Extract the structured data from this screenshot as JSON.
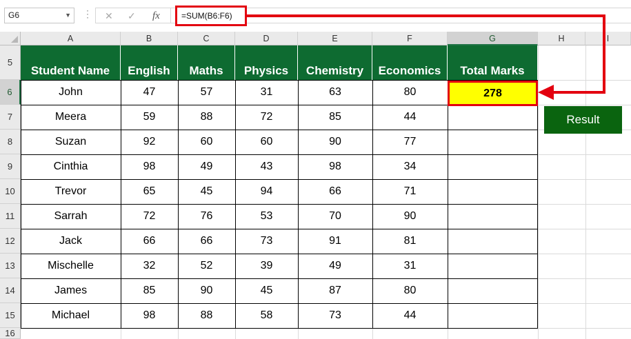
{
  "formula_bar": {
    "name_box": "G6",
    "cancel_icon": "✕",
    "enter_icon": "✓",
    "fx_label": "fx",
    "formula": "=SUM(B6:F6)"
  },
  "columns": [
    "A",
    "B",
    "C",
    "D",
    "E",
    "F",
    "G",
    "H",
    "I"
  ],
  "selected_column": "G",
  "rows": [
    "5",
    "6",
    "7",
    "8",
    "9",
    "10",
    "11",
    "12",
    "13",
    "14",
    "15",
    "16"
  ],
  "selected_row": "6",
  "table": {
    "headers": [
      "Student Name",
      "English",
      "Maths",
      "Physics",
      "Chemistry",
      "Economics",
      "Total Marks"
    ],
    "data": [
      [
        "John",
        "47",
        "57",
        "31",
        "63",
        "80",
        "278"
      ],
      [
        "Meera",
        "59",
        "88",
        "72",
        "85",
        "44",
        ""
      ],
      [
        "Suzan",
        "92",
        "60",
        "60",
        "90",
        "77",
        ""
      ],
      [
        "Cinthia",
        "98",
        "49",
        "43",
        "98",
        "34",
        ""
      ],
      [
        "Trevor",
        "65",
        "45",
        "94",
        "66",
        "71",
        ""
      ],
      [
        "Sarrah",
        "72",
        "76",
        "53",
        "70",
        "90",
        ""
      ],
      [
        "Jack",
        "66",
        "66",
        "73",
        "91",
        "81",
        ""
      ],
      [
        "Mischelle",
        "32",
        "52",
        "39",
        "49",
        "31",
        ""
      ],
      [
        "James",
        "85",
        "90",
        "45",
        "87",
        "80",
        ""
      ],
      [
        "Michael",
        "98",
        "88",
        "58",
        "73",
        "44",
        ""
      ]
    ]
  },
  "result_button": "Result",
  "colors": {
    "header_green": "#0e6b31",
    "highlight_yellow": "#ffff00",
    "annotation_red": "#e3000f",
    "button_green": "#0a640f"
  }
}
